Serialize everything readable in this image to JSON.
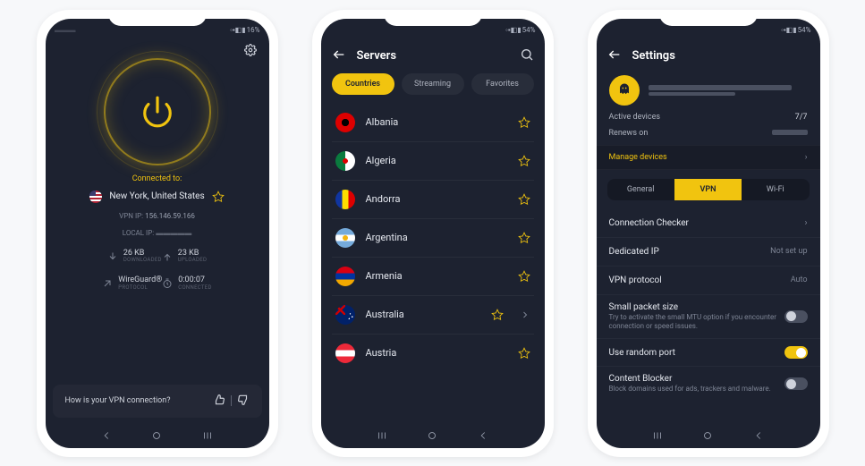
{
  "status": {
    "battery1": "16%",
    "battery2": "54%",
    "battery3": "54%",
    "sigicons": "▾◧◨▮"
  },
  "screen1": {
    "connected_label": "Connected to:",
    "location": "New York, United States",
    "vpn_ip_label": "VPN IP:",
    "vpn_ip": "156.146.59.166",
    "local_ip_label": "LOCAL IP:",
    "download_val": "26 KB",
    "download_sub": "DOWNLOADED",
    "upload_val": "23 KB",
    "upload_sub": "UPLOADED",
    "protocol_val": "WireGuard®",
    "protocol_sub": "PROTOCOL",
    "timer_val": "0:00:07",
    "timer_sub": "CONNECTED",
    "feedback_q": "How is your VPN connection?"
  },
  "screen2": {
    "title": "Servers",
    "tabs": [
      "Countries",
      "Streaming",
      "Favorites"
    ],
    "active_tab": 0,
    "servers": [
      "Albania",
      "Algeria",
      "Andorra",
      "Argentina",
      "Armenia",
      "Australia",
      "Austria"
    ]
  },
  "screen3": {
    "title": "Settings",
    "active_devices_label": "Active devices",
    "active_devices_val": "7/7",
    "renews_label": "Renews on",
    "manage": "Manage devices",
    "segments": [
      "General",
      "VPN",
      "Wi-Fi"
    ],
    "active_segment": 1,
    "conn_checker": "Connection Checker",
    "dedicated_ip": "Dedicated IP",
    "not_setup": "Not set up",
    "vpn_protocol": "VPN protocol",
    "auto": "Auto",
    "small_packet_h": "Small packet size",
    "small_packet_d": "Try to activate the small MTU option if you encounter connection or speed issues.",
    "random_port": "Use random port",
    "content_blocker_h": "Content Blocker",
    "content_blocker_d": "Block domains used for ads, trackers and malware."
  }
}
